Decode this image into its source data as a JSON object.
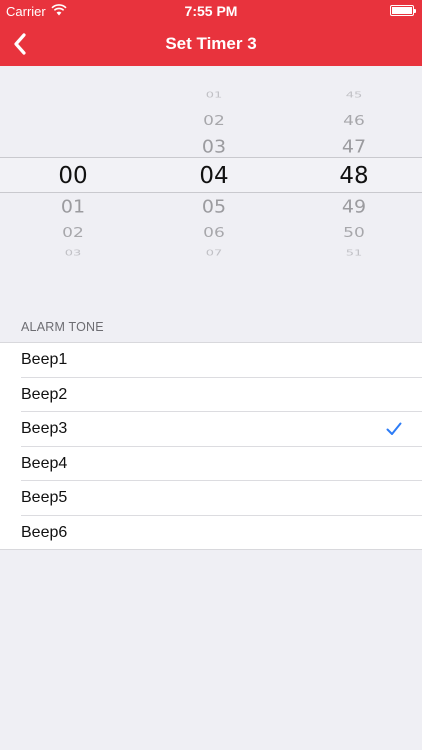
{
  "status_bar": {
    "carrier": "Carrier",
    "time": "7:55 PM"
  },
  "nav": {
    "title": "Set Timer 3",
    "back_icon": "chevron-left-icon"
  },
  "picker": {
    "hours": [
      "",
      "",
      "",
      "",
      "00",
      "01",
      "02",
      "03",
      ""
    ],
    "minutes": [
      "",
      "01",
      "02",
      "03",
      "04",
      "05",
      "06",
      "07",
      ""
    ],
    "seconds": [
      "",
      "45",
      "46",
      "47",
      "48",
      "49",
      "50",
      "51",
      ""
    ],
    "selected": {
      "hours": "00",
      "minutes": "04",
      "seconds": "48"
    }
  },
  "alarm_tone": {
    "header": "ALARM TONE",
    "items": [
      {
        "label": "Beep1",
        "selected": false
      },
      {
        "label": "Beep2",
        "selected": false
      },
      {
        "label": "Beep3",
        "selected": true
      },
      {
        "label": "Beep4",
        "selected": false
      },
      {
        "label": "Beep5",
        "selected": false
      },
      {
        "label": "Beep6",
        "selected": false
      }
    ],
    "check_icon": "checkmark-icon"
  },
  "colors": {
    "accent": "#e8333d",
    "check": "#2d7cf6",
    "background": "#efeff4"
  }
}
